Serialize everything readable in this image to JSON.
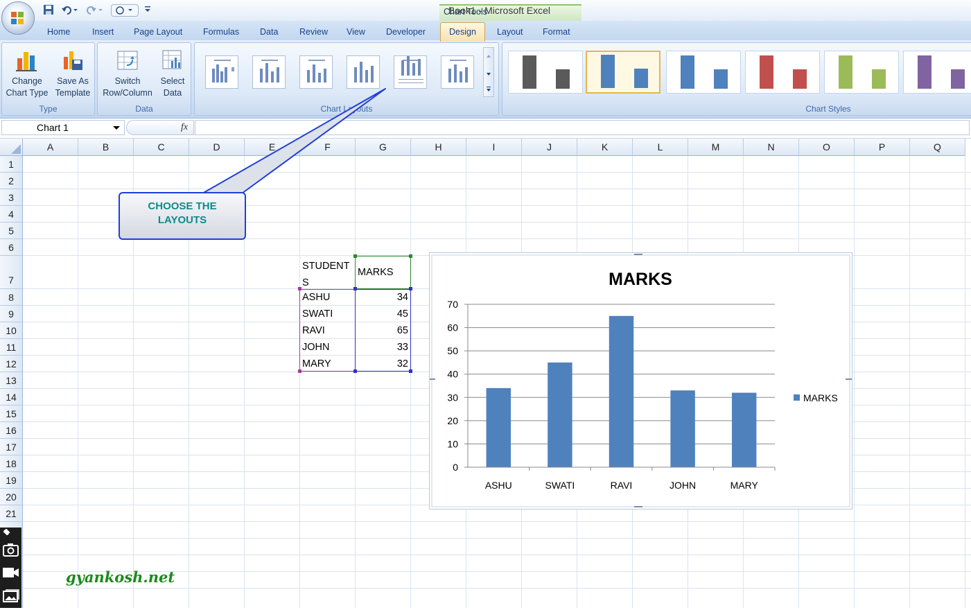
{
  "title_bar": {
    "app_title": "Book1 - Microsoft Excel",
    "context_tab": "Chart Tools"
  },
  "quick_access": {
    "items": [
      "save-icon",
      "undo-icon",
      "redo-icon",
      "customize-icon"
    ]
  },
  "tabs": [
    "Home",
    "Insert",
    "Page Layout",
    "Formulas",
    "Data",
    "Review",
    "View",
    "Developer",
    "Design",
    "Layout",
    "Format"
  ],
  "active_tab": "Design",
  "ribbon": {
    "type_group": {
      "label": "Type",
      "change_chart_type": [
        "Change",
        "Chart Type"
      ],
      "save_as_template": [
        "Save As",
        "Template"
      ]
    },
    "data_group": {
      "label": "Data",
      "switch_row_column": [
        "Switch",
        "Row/Column"
      ],
      "select_data": [
        "Select",
        "Data"
      ]
    },
    "layouts_group": {
      "label": "Chart Layouts",
      "count": 6
    },
    "styles_group": {
      "label": "Chart Styles",
      "styles": [
        "#5a5a5a",
        "#4f81bd",
        "#4f81bd",
        "#c0504d",
        "#9bbb59",
        "#8064a2"
      ],
      "selected_index": 1
    }
  },
  "formula_bar": {
    "name_box": "Chart 1",
    "fx_label": "fx"
  },
  "sheet": {
    "columns": [
      "A",
      "B",
      "C",
      "D",
      "E",
      "F",
      "G",
      "H",
      "I",
      "J",
      "K",
      "L",
      "M",
      "N",
      "O",
      "P",
      "Q"
    ],
    "rows": [
      "1",
      "2",
      "3",
      "4",
      "5",
      "6",
      "7",
      "8",
      "9",
      "10",
      "11",
      "12",
      "13",
      "14",
      "15",
      "16",
      "17",
      "18",
      "19",
      "20",
      "21"
    ],
    "header_students": [
      "STUDENT",
      "S"
    ],
    "header_marks": "MARKS",
    "students": [
      "ASHU",
      "SWATI",
      "RAVI",
      "JOHN",
      "MARY"
    ],
    "marks": [
      "34",
      "45",
      "65",
      "33",
      "32"
    ]
  },
  "callout": [
    "CHOOSE THE",
    "LAYOUTS"
  ],
  "watermark": "gyankosh.net",
  "chart_data": {
    "type": "bar",
    "title": "MARKS",
    "categories": [
      "ASHU",
      "SWATI",
      "RAVI",
      "JOHN",
      "MARY"
    ],
    "series": [
      {
        "name": "MARKS",
        "values": [
          34,
          45,
          65,
          33,
          32
        ],
        "color": "#4f81bd"
      }
    ],
    "ylim": [
      0,
      70
    ],
    "yticks": [
      0,
      10,
      20,
      30,
      40,
      50,
      60,
      70
    ],
    "grid": true,
    "legend": "right"
  }
}
